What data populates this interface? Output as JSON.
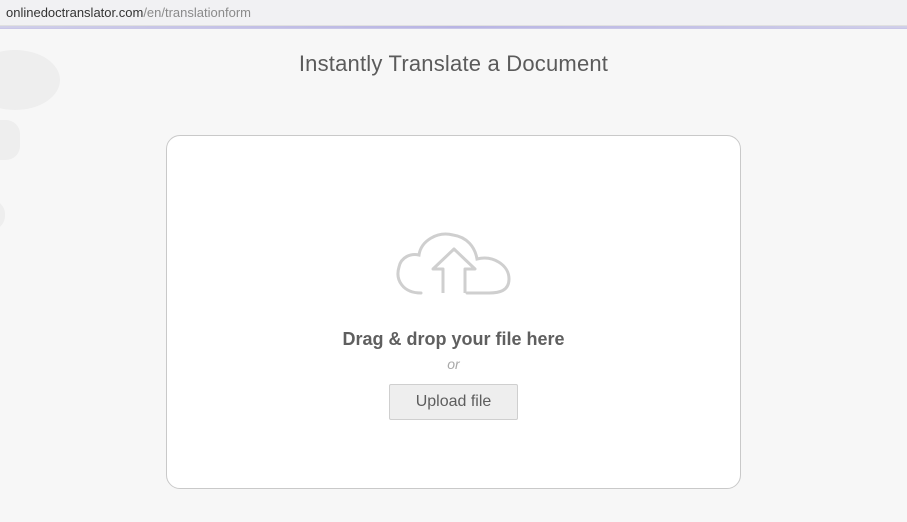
{
  "url": {
    "domain": "onlinedoctranslator.com",
    "path": "/en/translationform"
  },
  "page": {
    "title": "Instantly Translate a Document"
  },
  "dropzone": {
    "drop_label": "Drag & drop your file here",
    "or_label": "or",
    "upload_button": "Upload file",
    "icon_name": "cloud-upload-icon"
  },
  "colors": {
    "accent": "#b9b5e3",
    "text_primary": "#5b5b5b",
    "text_muted": "#a9a9a9",
    "border": "#c9c9c9"
  }
}
